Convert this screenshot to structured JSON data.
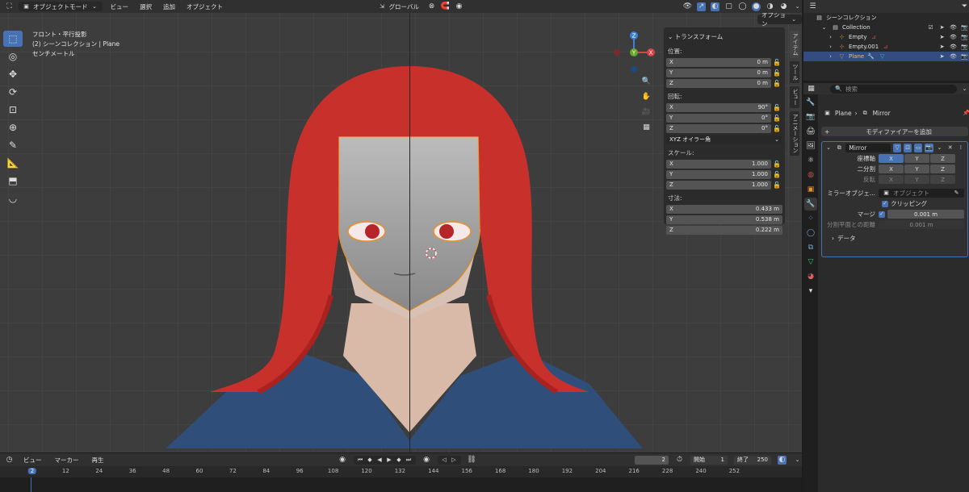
{
  "header": {
    "mode": "オブジェクトモード",
    "menus": [
      "ビュー",
      "選択",
      "追加",
      "オブジェクト"
    ],
    "transform_orientation": "グローバル",
    "options": "オプション"
  },
  "viewport": {
    "line1": "フロント・平行投影",
    "line2": "(2) シーンコレクション | Plane",
    "line3": "センチメートル"
  },
  "npanel": {
    "title": "トランスフォーム",
    "location_label": "位置:",
    "location": [
      {
        "axis": "X",
        "value": "0 m"
      },
      {
        "axis": "Y",
        "value": "0 m"
      },
      {
        "axis": "Z",
        "value": "0 m"
      }
    ],
    "rotation_label": "回転:",
    "rotation": [
      {
        "axis": "X",
        "value": "90°"
      },
      {
        "axis": "Y",
        "value": "0°"
      },
      {
        "axis": "Z",
        "value": "0°"
      }
    ],
    "rotation_mode": "XYZ オイラー角",
    "scale_label": "スケール:",
    "scale": [
      {
        "axis": "X",
        "value": "1.000"
      },
      {
        "axis": "Y",
        "value": "1.000"
      },
      {
        "axis": "Z",
        "value": "1.000"
      }
    ],
    "dimensions_label": "寸法:",
    "dimensions": [
      {
        "axis": "X",
        "value": "0.433 m"
      },
      {
        "axis": "Y",
        "value": "0.538 m"
      },
      {
        "axis": "Z",
        "value": "0.222 m"
      }
    ],
    "side_tabs": [
      "アイテム",
      "ツール",
      "ビュー",
      "アニメーション"
    ]
  },
  "gizmo": {
    "z": "Z",
    "y": "Y",
    "x": "X"
  },
  "timeline": {
    "menus": [
      "ビュー",
      "マーカー",
      "再生"
    ],
    "current_frame": "2",
    "start_label": "開始",
    "start": "1",
    "end_label": "終了",
    "end": "250",
    "ticks": [
      "2",
      "12",
      "24",
      "36",
      "48",
      "60",
      "72",
      "84",
      "96",
      "108",
      "120",
      "132",
      "144",
      "156",
      "168",
      "180",
      "192",
      "204",
      "216",
      "228",
      "240",
      "252"
    ]
  },
  "outliner": {
    "scene_collection": "シーンコレクション",
    "collection": "Collection",
    "items": [
      {
        "name": "Empty"
      },
      {
        "name": "Empty.001"
      },
      {
        "name": "Plane"
      }
    ]
  },
  "properties": {
    "search_placeholder": "検索",
    "breadcrumb_object": "Plane",
    "breadcrumb_modifier": "Mirror",
    "add_modifier": "モディファイアーを追加",
    "modifier_name": "Mirror",
    "axis_label": "座標軸",
    "bisect_label": "二分割",
    "flip_label": "反転",
    "axes": [
      "X",
      "Y",
      "Z"
    ],
    "mirror_object_label": "ミラーオブジェ...",
    "mirror_object_placeholder": "オブジェクト",
    "clipping_label": "クリッピング",
    "merge_label": "マージ",
    "merge_value": "0.001 m",
    "bisect_distance_label": "分割平面との距離",
    "bisect_distance_value": "0.001 m",
    "data_label": "データ"
  },
  "colors": {
    "accent": "#4772b3",
    "hair": "#c8302c",
    "selection": "#e8912a",
    "shirt": "#2f4e7a"
  }
}
